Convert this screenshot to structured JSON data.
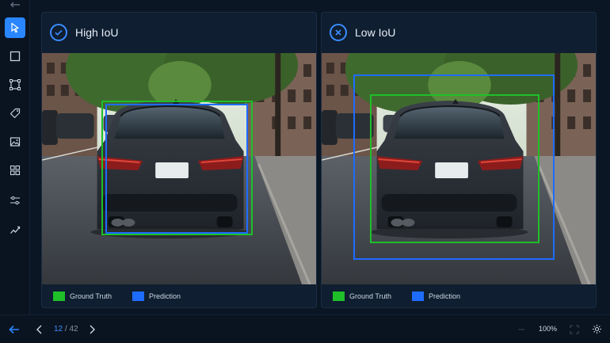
{
  "colors": {
    "accent": "#2a86ff",
    "ground_truth": "#1fbf2a",
    "prediction": "#1e6cff",
    "background": "#0b1624",
    "panel": "#0f1e31"
  },
  "toolbar": {
    "items": [
      {
        "name": "select-tool",
        "icon": "cursor-icon",
        "active": true
      },
      {
        "name": "rectangle-tool",
        "icon": "square-icon"
      },
      {
        "name": "bbox-tool",
        "icon": "bbox-icon"
      },
      {
        "name": "tag-tool",
        "icon": "tag-icon"
      },
      {
        "name": "image-tool",
        "icon": "image-icon"
      },
      {
        "name": "grid-tool",
        "icon": "grid-icon"
      },
      {
        "name": "adjust-tool",
        "icon": "sliders-icon"
      },
      {
        "name": "chart-tool",
        "icon": "trend-icon"
      }
    ]
  },
  "panels": [
    {
      "title": "High IoU",
      "status_icon": "check-icon",
      "legend_gt": "Ground Truth",
      "legend_pred": "Prediction"
    },
    {
      "title": "Low IoU",
      "status_icon": "close-icon",
      "legend_gt": "Ground Truth",
      "legend_pred": "Prediction"
    }
  ],
  "pagination": {
    "current": "12",
    "separator": " / ",
    "total": "42"
  },
  "zoom": "100%"
}
